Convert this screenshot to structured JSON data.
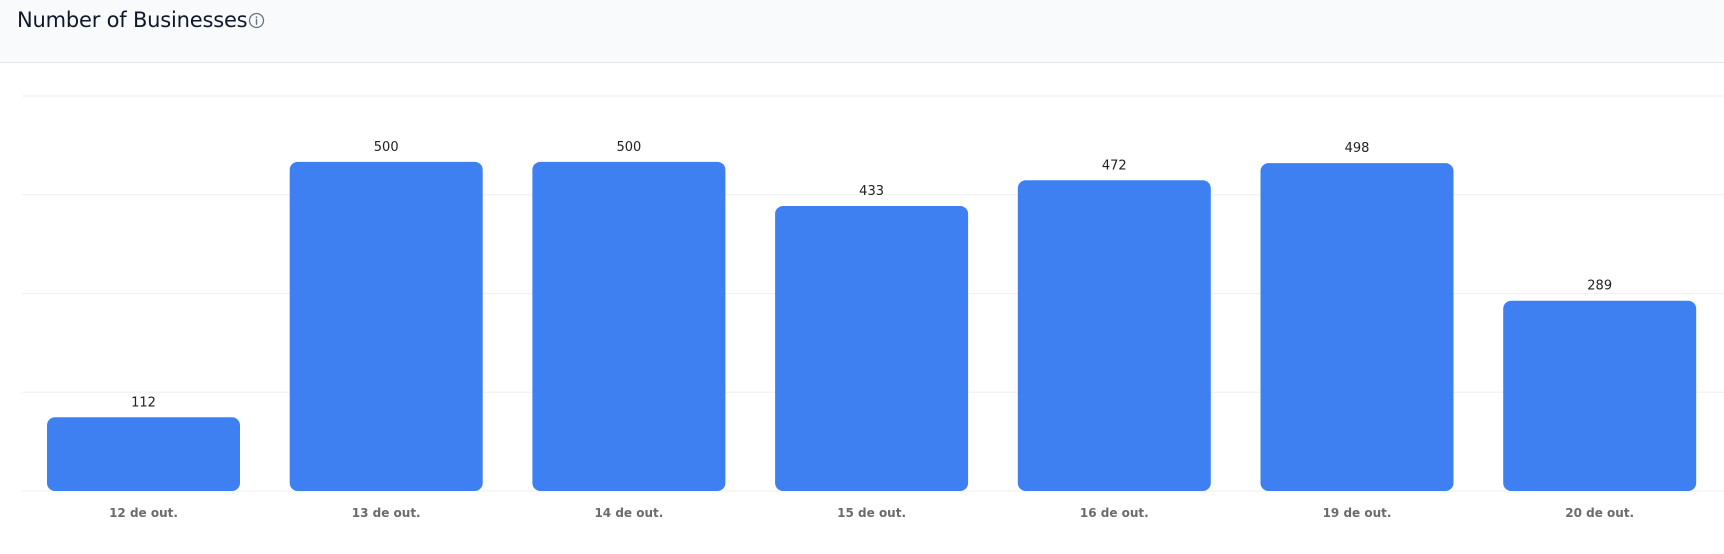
{
  "header": {
    "title": "Number of Businesses",
    "info_icon": "info-icon"
  },
  "colors": {
    "bar": "#3e80f2",
    "header_bg": "#f9fafb",
    "grid": "#eef0f2"
  },
  "chart_data": {
    "type": "bar",
    "title": "Number of Businesses",
    "categories": [
      "12 de out.",
      "13 de out.",
      "14 de out.",
      "15 de out.",
      "16 de out.",
      "19 de out.",
      "20 de out."
    ],
    "values": [
      112,
      500,
      500,
      433,
      472,
      498,
      289
    ],
    "data_labels": [
      "112",
      "500",
      "500",
      "433",
      "472",
      "498",
      "289"
    ],
    "ylim": [
      0,
      600
    ],
    "grid": true,
    "legend": "none"
  }
}
